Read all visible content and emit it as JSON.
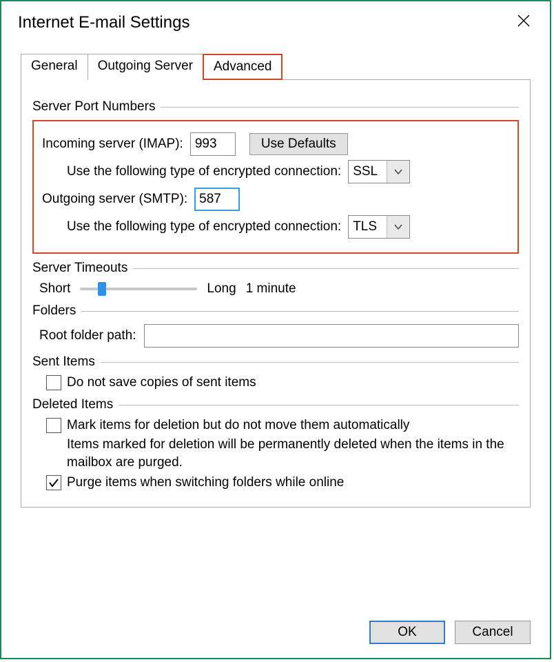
{
  "window": {
    "title": "Internet E-mail Settings"
  },
  "tabs": [
    "General",
    "Outgoing Server",
    "Advanced"
  ],
  "server_ports": {
    "group_title": "Server Port Numbers",
    "incoming_label": "Incoming server (IMAP):",
    "incoming_port": "993",
    "defaults_button": "Use Defaults",
    "encryption_label": "Use the following type of encrypted connection:",
    "incoming_encryption": "SSL",
    "outgoing_label": "Outgoing server (SMTP):",
    "outgoing_port": "587",
    "outgoing_encryption": "TLS"
  },
  "timeouts": {
    "group_title": "Server Timeouts",
    "short_label": "Short",
    "long_label": "Long",
    "value_label": "1 minute"
  },
  "folders": {
    "group_title": "Folders",
    "root_label": "Root folder path:",
    "root_value": ""
  },
  "sent_items": {
    "group_title": "Sent Items",
    "checkbox_label": "Do not save copies of sent items",
    "checked": false
  },
  "deleted_items": {
    "group_title": "Deleted Items",
    "mark_label": "Mark items for deletion but do not move them automatically",
    "mark_checked": false,
    "desc": "Items marked for deletion will be permanently deleted when the items in the mailbox are purged.",
    "purge_label": "Purge items when switching folders while online",
    "purge_checked": true
  },
  "buttons": {
    "ok": "OK",
    "cancel": "Cancel"
  }
}
